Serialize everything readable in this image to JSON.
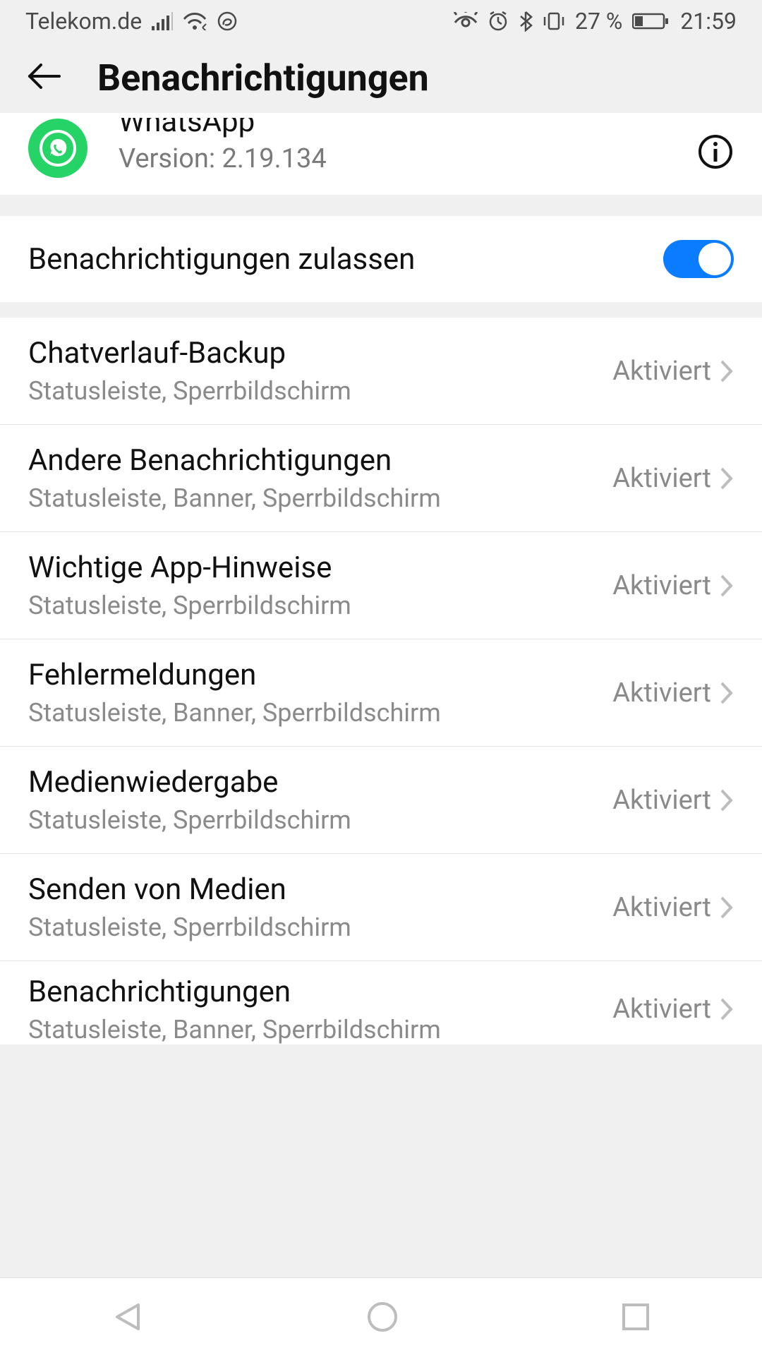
{
  "statusbar": {
    "carrier": "Telekom.de",
    "battery_text": "27 %",
    "time": "21:59"
  },
  "header": {
    "title": "Benachrichtigungen"
  },
  "app": {
    "name": "WhatsApp",
    "version": "Version: 2.19.134"
  },
  "allow": {
    "label": "Benachrichtigungen zulassen",
    "enabled": true
  },
  "channels": [
    {
      "title": "Chatverlauf-Backup",
      "subtitle": "Statusleiste, Sperrbildschirm",
      "status": "Aktiviert"
    },
    {
      "title": "Andere Benachrichtigungen",
      "subtitle": "Statusleiste, Banner, Sperrbildschirm",
      "status": "Aktiviert"
    },
    {
      "title": "Wichtige App-Hinweise",
      "subtitle": "Statusleiste, Sperrbildschirm",
      "status": "Aktiviert"
    },
    {
      "title": "Fehlermeldungen",
      "subtitle": "Statusleiste, Banner, Sperrbildschirm",
      "status": "Aktiviert"
    },
    {
      "title": "Medienwiedergabe",
      "subtitle": "Statusleiste, Sperrbildschirm",
      "status": "Aktiviert"
    },
    {
      "title": "Senden von Medien",
      "subtitle": "Statusleiste, Sperrbildschirm",
      "status": "Aktiviert"
    },
    {
      "title": "Benachrichtigungen",
      "subtitle": "Statusleiste, Banner, Sperrbildschirm",
      "status": "Aktiviert"
    }
  ]
}
